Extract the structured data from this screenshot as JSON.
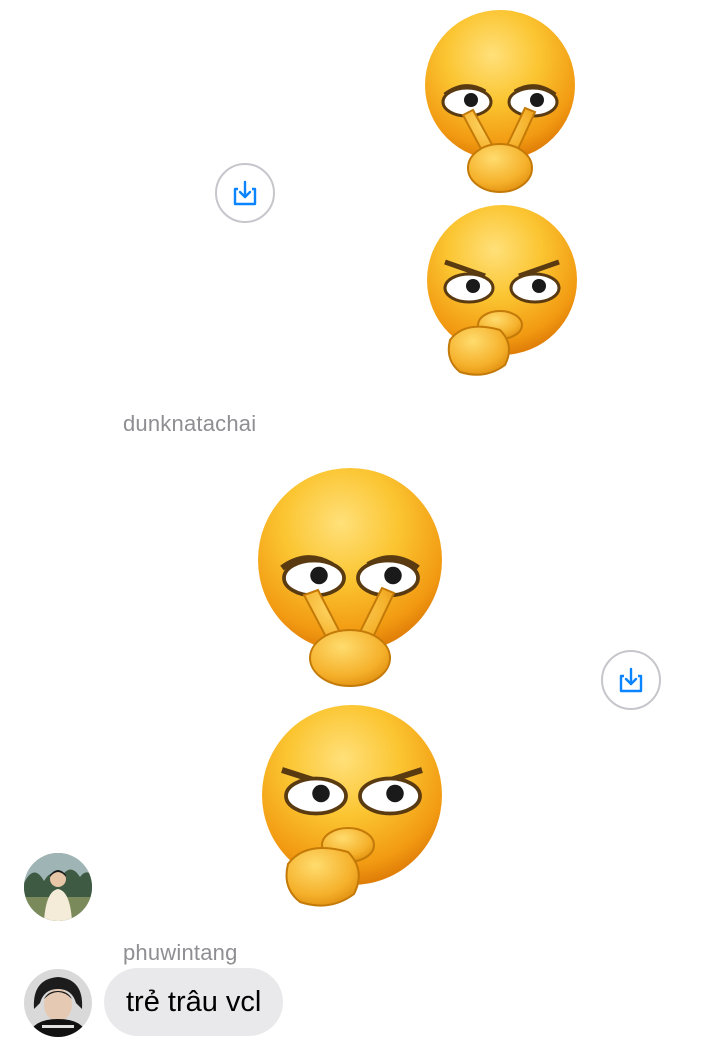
{
  "messages": [
    {
      "type": "image",
      "content": "emoji-sticker",
      "share_icon": "share-download-icon"
    },
    {
      "sender": "dunknatachai",
      "type": "image",
      "content": "emoji-sticker",
      "share_icon": "share-download-icon"
    },
    {
      "sender": "phuwintang",
      "type": "text",
      "text": "trẻ trâu vcl"
    }
  ],
  "colors": {
    "bubble_bg": "#e9e9eb",
    "username_text": "#8e8e93",
    "share_icon": "#0a84ff",
    "emoji_face": "#f7b52a"
  }
}
